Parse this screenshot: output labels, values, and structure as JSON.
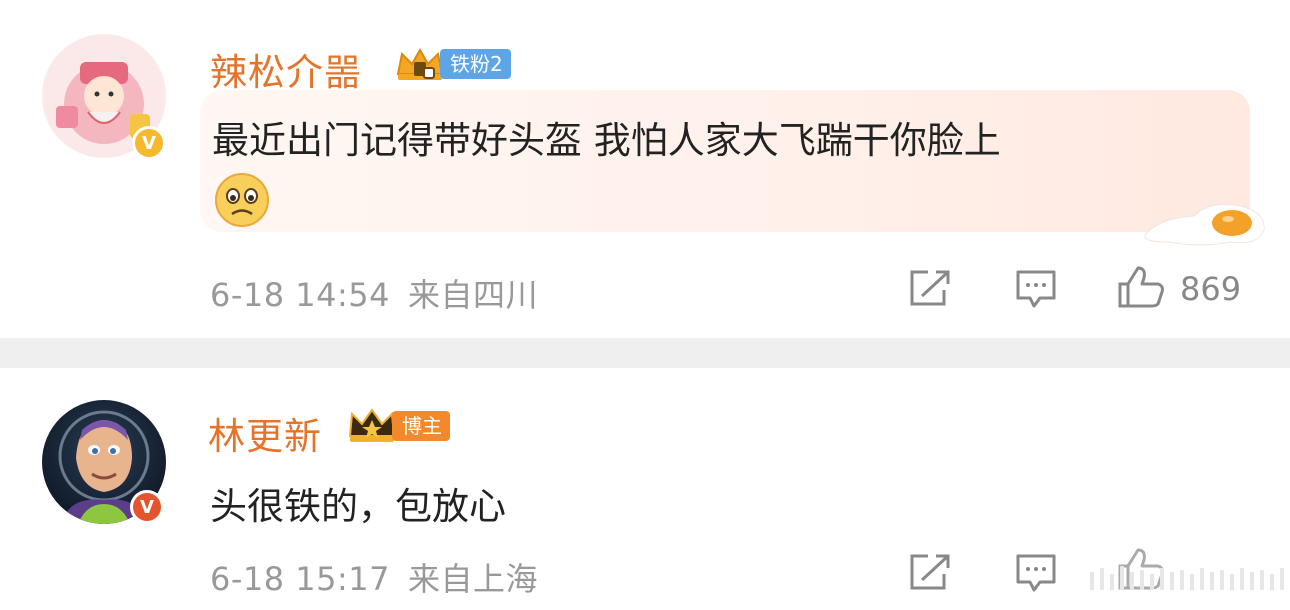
{
  "comments": [
    {
      "username": "辣松介噐",
      "badge_text": "铁粉2",
      "text": "最近出门记得带好头盔 我怕人家大飞踹干你脸上",
      "date": "6-18 14:54",
      "location": "来自四川",
      "likes": "869",
      "verified_color": "#f5b82e"
    },
    {
      "username": "林更新",
      "badge_text": "博主",
      "text": "头很铁的，包放心",
      "date": "6-18 15:17",
      "location": "来自上海",
      "verified_color": "#e4542d"
    }
  ],
  "icons": [
    "share-icon",
    "comment-icon",
    "like-icon",
    "sad-emoji-icon",
    "fried-egg-icon",
    "crown-icon"
  ],
  "colors": {
    "username": "#e5742b",
    "meta": "#999999",
    "divider": "#efefef",
    "badge_blue": "#5ea5e8",
    "badge_orange": "#f28a2d"
  }
}
